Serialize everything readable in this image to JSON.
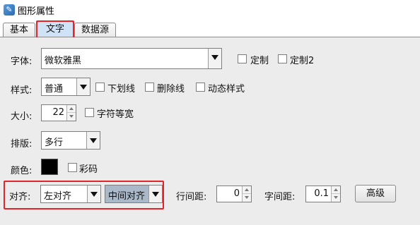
{
  "window": {
    "title": "图形属性"
  },
  "tabs": [
    {
      "label": "基本"
    },
    {
      "label": "文字"
    },
    {
      "label": "数据源"
    }
  ],
  "form": {
    "font": {
      "label": "字体:",
      "value": "微软雅黑",
      "custom1_label": "定制",
      "custom2_label": "定制2"
    },
    "style": {
      "label": "样式:",
      "value": "普通",
      "underline_label": "下划线",
      "strikethrough_label": "删除线",
      "dynamic_label": "动态样式"
    },
    "size": {
      "label": "大小:",
      "value": "22",
      "monospace_label": "字符等宽"
    },
    "layout": {
      "label": "排版:",
      "value": "多行"
    },
    "color": {
      "label": "颜色:",
      "swatch": "#000000",
      "rainbow_label": "彩码"
    },
    "align": {
      "label": "对齐:",
      "horizontal": "左对齐",
      "vertical": "中间对齐",
      "line_spacing_label": "行间距:",
      "line_spacing": "0",
      "char_spacing_label": "字间距:",
      "char_spacing": "0.1",
      "advanced_label": "高级"
    }
  },
  "colors": {
    "selected_tab": "#cfe2f6",
    "highlight_box": "#e0262b",
    "panel_bg": "#ececec"
  }
}
